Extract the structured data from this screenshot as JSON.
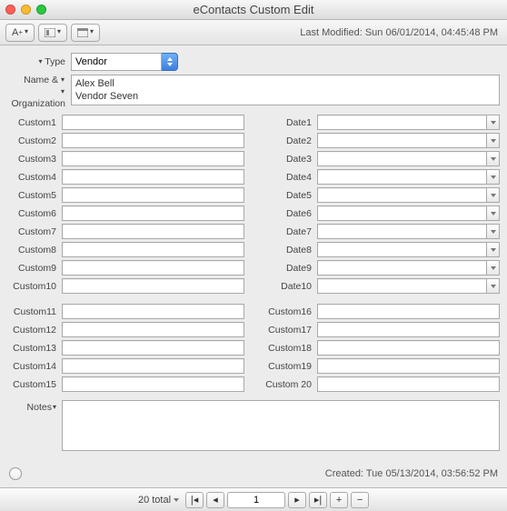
{
  "window": {
    "title": "eContacts Custom Edit"
  },
  "toolbar": {
    "last_modified": "Last Modified: Sun 06/01/2014, 04:45:48 PM"
  },
  "type": {
    "label": "Type",
    "value": "Vendor"
  },
  "name_org": {
    "label1": "Name &",
    "label2": "Organization",
    "line1": "Alex Bell",
    "line2": "Vendor Seven"
  },
  "left1": [
    {
      "label": "Custom1",
      "value": ""
    },
    {
      "label": "Custom2",
      "value": ""
    },
    {
      "label": "Custom3",
      "value": ""
    },
    {
      "label": "Custom4",
      "value": ""
    },
    {
      "label": "Custom5",
      "value": ""
    },
    {
      "label": "Custom6",
      "value": ""
    },
    {
      "label": "Custom7",
      "value": ""
    },
    {
      "label": "Custom8",
      "value": ""
    },
    {
      "label": "Custom9",
      "value": ""
    },
    {
      "label": "Custom10",
      "value": ""
    }
  ],
  "right1": [
    {
      "label": "Date1",
      "value": ""
    },
    {
      "label": "Date2",
      "value": ""
    },
    {
      "label": "Date3",
      "value": ""
    },
    {
      "label": "Date4",
      "value": ""
    },
    {
      "label": "Date5",
      "value": ""
    },
    {
      "label": "Date6",
      "value": ""
    },
    {
      "label": "Date7",
      "value": ""
    },
    {
      "label": "Date8",
      "value": ""
    },
    {
      "label": "Date9",
      "value": ""
    },
    {
      "label": "Date10",
      "value": ""
    }
  ],
  "left2": [
    {
      "label": "Custom11",
      "value": ""
    },
    {
      "label": "Custom12",
      "value": ""
    },
    {
      "label": "Custom13",
      "value": ""
    },
    {
      "label": "Custom14",
      "value": ""
    },
    {
      "label": "Custom15",
      "value": ""
    }
  ],
  "right2": [
    {
      "label": "Custom16",
      "value": ""
    },
    {
      "label": "Custom17",
      "value": ""
    },
    {
      "label": "Custom18",
      "value": ""
    },
    {
      "label": "Custom19",
      "value": ""
    },
    {
      "label": "Custom 20",
      "value": ""
    }
  ],
  "notes": {
    "label": "Notes",
    "value": ""
  },
  "footer": {
    "created": "Created: Tue 05/13/2014, 03:56:52 PM"
  },
  "nav": {
    "total_label": "20 total",
    "page": "1"
  }
}
